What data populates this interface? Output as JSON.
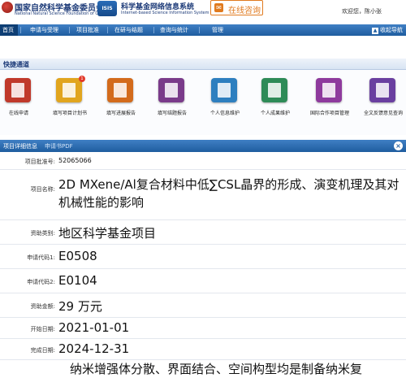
{
  "header": {
    "nsfc_name_cn": "国家自然科学基金委员会",
    "nsfc_name_en": "National Natural Science Foundation of China",
    "isis_logo": "ISIS",
    "isis_name_cn": "科学基金网络信息系统",
    "isis_name_en": "Internet-based Science Information System",
    "consult_label": "在线咨询",
    "welcome": "欢迎您，陈小张"
  },
  "nav": {
    "items": [
      "首页",
      "申请与受理",
      "项目批准",
      "在研与结题",
      "查询与统计",
      "管理"
    ],
    "collapse_label": "收起导航"
  },
  "quick": {
    "title": "快捷通道",
    "items": [
      {
        "label": "在线申请",
        "color": "#c0392b"
      },
      {
        "label": "填写项目计划书",
        "color": "#e1a51e",
        "badge": "1"
      },
      {
        "label": "填写进展报告",
        "color": "#d36b1c"
      },
      {
        "label": "填写结题报告",
        "color": "#7a3b8a"
      },
      {
        "label": "个人信息维护",
        "color": "#2e7fbf"
      },
      {
        "label": "个人成果维护",
        "color": "#2e8b57"
      },
      {
        "label": "国际合作项目管理",
        "color": "#8e3a9d"
      },
      {
        "label": "全文反馈意见查询",
        "color": "#6a3fa0"
      }
    ]
  },
  "detail": {
    "title": "项目详细信息",
    "pdf_link": "申请书PDF",
    "close": "×",
    "rows": [
      {
        "label": "项目批准号:",
        "value": "52065066"
      },
      {
        "label": "项目名称:",
        "value": "2D MXene/Al复合材料中低∑CSL晶界的形成、演变机理及其对机械性能的影响"
      },
      {
        "label": "资助类别:",
        "value": "地区科学基金项目"
      },
      {
        "label": "申请代码1:",
        "value": "E0508"
      },
      {
        "label": "申请代码2:",
        "value": "E0104"
      },
      {
        "label": "资助金额:",
        "value": "29 万元"
      },
      {
        "label": "开始日期:",
        "value": "2021-01-01"
      },
      {
        "label": "完成日期:",
        "value": "2024-12-31"
      },
      {
        "label": "",
        "value": "纳米增强体分散、界面结合、空间构型均是制备纳米复"
      }
    ]
  }
}
